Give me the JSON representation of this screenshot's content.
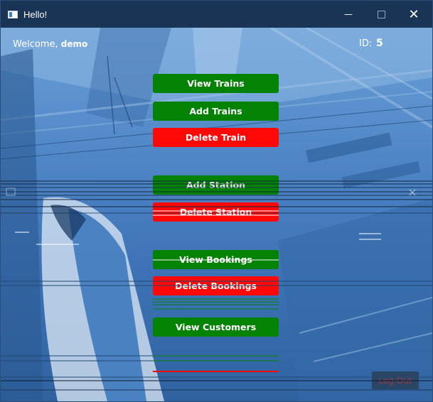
{
  "window": {
    "title": "Hello!",
    "min_glyph": "—",
    "close_glyph": "✕"
  },
  "header": {
    "welcome_prefix": "Welcome,",
    "username": "demo",
    "id_label": "ID:",
    "id_value": "5"
  },
  "actions": {
    "view_trains": "View Trains",
    "add_trains": "Add Trains",
    "delete_train": "Delete Train",
    "add_station": "Add Station",
    "delete_station": "Delete Station",
    "view_bookings": "View Bookings",
    "delete_bookings": "Delete Bookings",
    "view_customers": "View Customers"
  },
  "footer": {
    "logout_label": "Log Out"
  },
  "colors": {
    "primary_green": "#038204",
    "danger_red": "#ff0808",
    "titlebar": "#1a3456"
  }
}
